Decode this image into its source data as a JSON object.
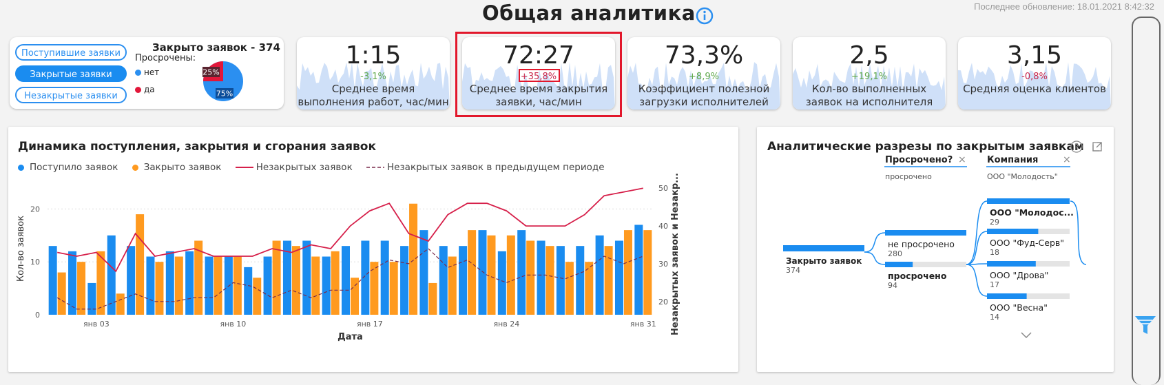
{
  "page": {
    "title": "Общая аналитика",
    "updated": "Последнее обновление: 18.01.2021 8:42:32"
  },
  "slicer": {
    "buttons": [
      "Поступившие заявки",
      "Закрытые заявки",
      "Незакрытые заявки"
    ],
    "active": 1,
    "closed_title": "Закрыто заявок - 374",
    "overdue_label": "Просрочены:",
    "legend": [
      {
        "label": "нет",
        "color": "#2b8ff0"
      },
      {
        "label": "да",
        "color": "#e2173a"
      }
    ],
    "pie": {
      "yes_label": "25%",
      "no_label": "75%",
      "yes_share": 0.25
    }
  },
  "kpis": [
    {
      "value": "1:15",
      "delta": "-3,1%",
      "trend": "pos",
      "label": "Среднее время выполнения работ, час/мин"
    },
    {
      "value": "72:27",
      "delta": "+35,8%",
      "trend": "neg",
      "label": "Среднее время закрытия заявки, час/мин"
    },
    {
      "value": "73,3%",
      "delta": "+8,9%",
      "trend": "pos",
      "label": "Коэффициент полезной загрузки исполнителей"
    },
    {
      "value": "2,5",
      "delta": "+19,1%",
      "trend": "pos",
      "label": "Кол-во выполненных заявок на исполнителя"
    },
    {
      "value": "3,15",
      "delta": "-0,8%",
      "trend": "neg",
      "label": "Средняя оценка клиентов"
    }
  ],
  "chart": {
    "title": "Динамика поступления, закрытия и сгорания заявок",
    "legend": [
      "Поступило заявок",
      "Закрыто заявок",
      "Незакрытых заявок",
      "Незакрытых заявок в предыдущем периоде"
    ],
    "colors": {
      "received": "#1a8cf0",
      "closed": "#ff9a1f",
      "open": "#d6204a",
      "prev": "#7a2a4c"
    }
  },
  "chart_data": {
    "type": "bar",
    "title": "Динамика поступления, закрытия и сгорания заявок",
    "xlabel": "Дата",
    "ylabel": "Кол-во заявок",
    "y2label": "Незакрытых заявок и Незакр...",
    "x_ticks": [
      "янв 03",
      "янв 10",
      "янв 17",
      "янв 24",
      "янв 31"
    ],
    "x_tick_index": [
      2,
      9,
      16,
      23,
      30
    ],
    "ylim": [
      0,
      25
    ],
    "y_ticks": [
      0,
      10,
      20
    ],
    "y2lim": [
      16.5,
      51.5
    ],
    "y2_ticks": [
      20,
      30,
      40,
      50
    ],
    "series": [
      {
        "name": "Поступило заявок",
        "axis": "left",
        "kind": "bar",
        "values": [
          13,
          12,
          6,
          15,
          13,
          11,
          12,
          12,
          11,
          11,
          9,
          11,
          14,
          14,
          11,
          13,
          14,
          14,
          13,
          16,
          13,
          13,
          16,
          12,
          16,
          14,
          13,
          13,
          15,
          14,
          17
        ]
      },
      {
        "name": "Закрыто заявок",
        "axis": "left",
        "kind": "bar",
        "values": [
          8,
          10,
          12,
          4,
          19,
          10,
          11,
          14,
          11,
          11,
          7,
          14,
          13,
          11,
          12,
          7,
          10,
          10,
          21,
          6,
          11,
          16,
          15,
          15,
          14,
          13,
          10,
          10,
          13,
          16,
          16
        ]
      },
      {
        "name": "Незакрытых заявок",
        "axis": "right",
        "kind": "line",
        "values": [
          33,
          32,
          33,
          28,
          38,
          32,
          33,
          34,
          32,
          32,
          32,
          34,
          33,
          35,
          34,
          40,
          44,
          46,
          38,
          36,
          43,
          46,
          46,
          44,
          40,
          40,
          40,
          43,
          48,
          49,
          50
        ]
      },
      {
        "name": "Незакрытых заявок в предыдущем периоде",
        "axis": "right",
        "kind": "dashed",
        "values": [
          21,
          18,
          18,
          20,
          22,
          20,
          20,
          21,
          21,
          25,
          24,
          21,
          23,
          21,
          23,
          23,
          28,
          31,
          30,
          34,
          29,
          31,
          27,
          25,
          27,
          27,
          26,
          28,
          32,
          30,
          32
        ]
      }
    ]
  },
  "decomp": {
    "title": "Аналитические разрезы по закрытым заявкам",
    "root": {
      "label": "Закрыто заявок",
      "value": "374"
    },
    "col1": {
      "header": "Просрочено?",
      "sub": "просрочено",
      "items": [
        {
          "label": "не просрочено",
          "value": "280",
          "share": 1.0,
          "bold": false
        },
        {
          "label": "просрочено",
          "value": "94",
          "share": 0.34,
          "bold": true
        }
      ]
    },
    "col2": {
      "header": "Компания",
      "sub": "ООО \"Молодость\"",
      "items": [
        {
          "label": "ООО \"Молодос...",
          "value": "29",
          "share": 1.0,
          "bold": true
        },
        {
          "label": "ООО \"Фуд-Серв\"",
          "value": "18",
          "share": 0.62,
          "bold": false
        },
        {
          "label": "ООО \"Дрова\"",
          "value": "17",
          "share": 0.59,
          "bold": false
        },
        {
          "label": "ООО \"Весна\"",
          "value": "14",
          "share": 0.48,
          "bold": false
        }
      ]
    }
  }
}
